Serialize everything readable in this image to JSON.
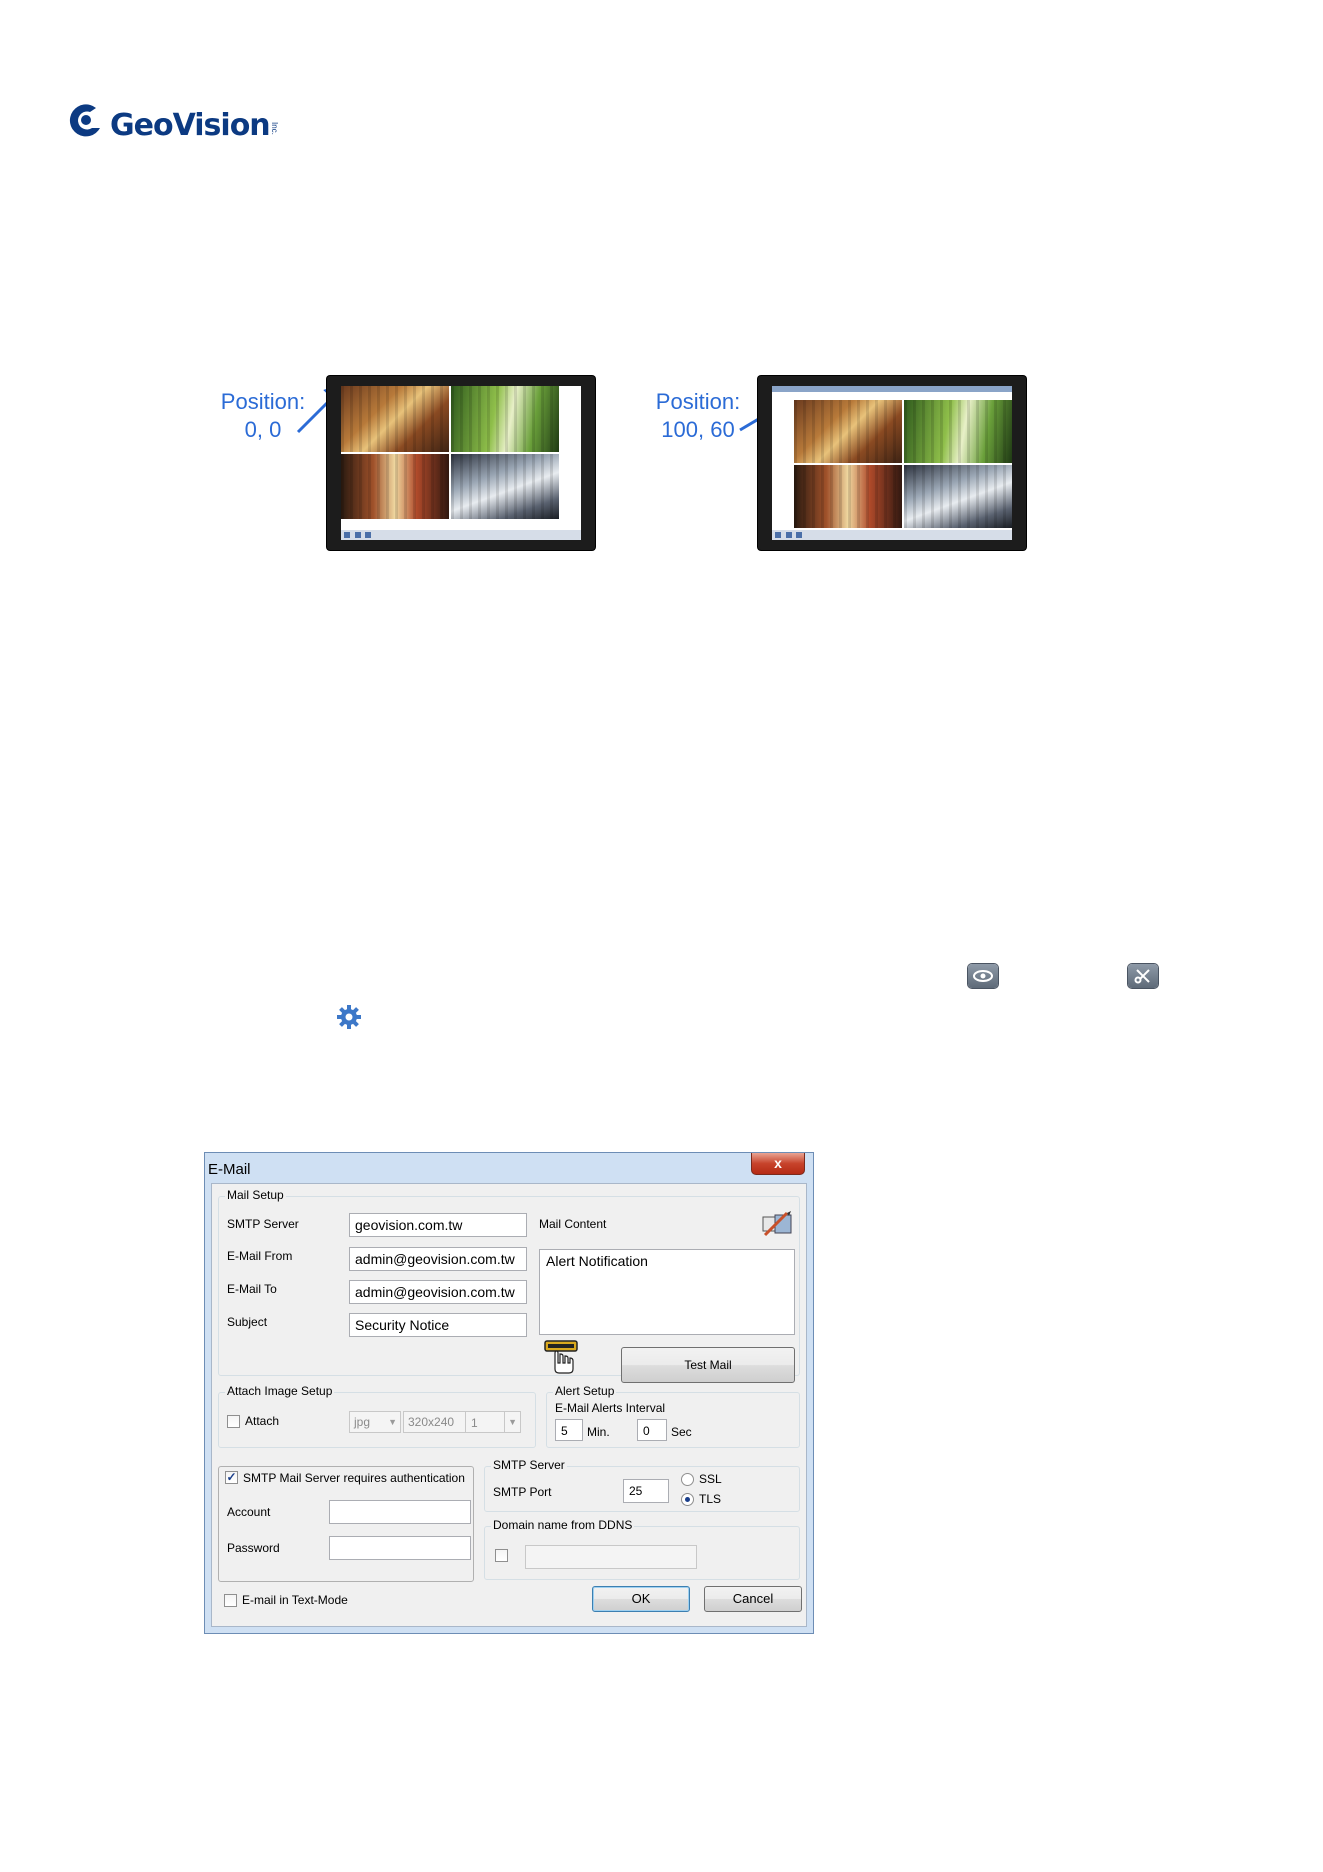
{
  "logo": {
    "brand": "GeoVision",
    "small_text": "Inc."
  },
  "position_examples": [
    {
      "label_line1": "Position:",
      "label_line2": "0, 0"
    },
    {
      "label_line1": "Position:",
      "label_line2": "100, 60"
    }
  ],
  "inline_icons": [
    "eye-icon",
    "tools-icon",
    "gear-icon"
  ],
  "dialog": {
    "title": "E-Mail",
    "close": "x",
    "mail_setup": {
      "group_label": "Mail Setup",
      "smtp_server_label": "SMTP Server",
      "smtp_server_value": "geovision.com.tw",
      "email_from_label": "E-Mail From",
      "email_from_value": "admin@geovision.com.tw",
      "email_to_label": "E-Mail To",
      "email_to_value": "admin@geovision.com.tw",
      "subject_label": "Subject",
      "subject_value": "Security Notice",
      "mail_content_label": "Mail Content",
      "mail_content_value": "Alert Notification",
      "test_mail_button": "Test Mail"
    },
    "attach_image": {
      "group_label": "Attach Image Setup",
      "attach_label": "Attach",
      "attach_checked": false,
      "format": "jpg",
      "resolution": "320x240",
      "count": "1"
    },
    "alert_setup": {
      "group_label": "Alert Setup",
      "interval_label": "E-Mail Alerts Interval",
      "minutes": "5",
      "min_unit": "Min.",
      "seconds": "0",
      "sec_unit": "Sec"
    },
    "auth": {
      "checkbox_label": "SMTP Mail Server requires authentication",
      "checked": true,
      "account_label": "Account",
      "account_value": "",
      "password_label": "Password",
      "password_value": ""
    },
    "smtp_server": {
      "group_label": "SMTP Server",
      "port_label": "SMTP Port",
      "port_value": "25",
      "ssl_label": "SSL",
      "tls_label": "TLS",
      "selected": "TLS"
    },
    "ddns": {
      "group_label": "Domain name from DDNS",
      "checked": false,
      "value": ""
    },
    "text_mode": {
      "label": "E-mail in Text-Mode",
      "checked": false
    },
    "ok_button": "OK",
    "cancel_button": "Cancel"
  }
}
